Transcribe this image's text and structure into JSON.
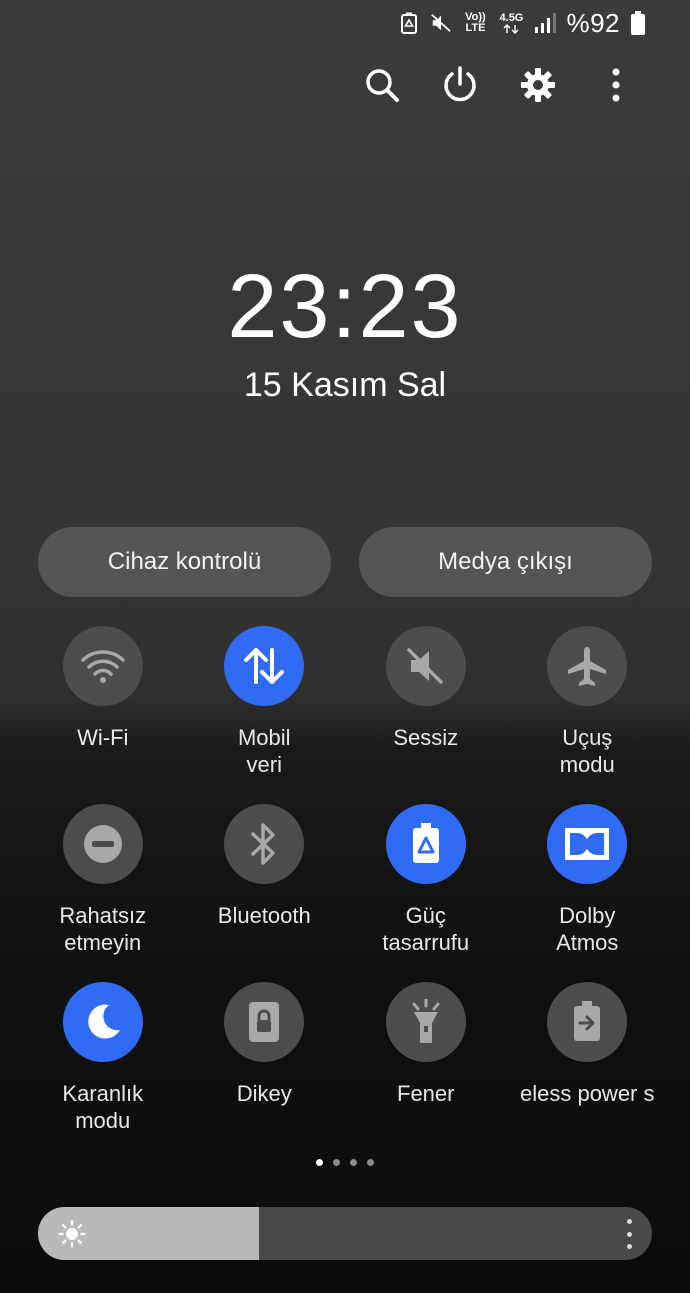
{
  "status_bar": {
    "icons": [
      "battery-saver-icon",
      "mute-icon",
      "volte-icon",
      "data-arrows-icon",
      "signal-icon",
      "battery-icon"
    ],
    "volte_top": "Vo))",
    "volte_bottom": "LTE",
    "network": "4.5G",
    "battery_percent": "%92"
  },
  "top_actions": [
    "search-icon",
    "power-icon",
    "gear-icon",
    "more-vertical-icon"
  ],
  "clock": {
    "time": "23:23",
    "date": "15 Kasım Sal"
  },
  "pills": {
    "device_control": "Cihaz kontrolü",
    "media_output": "Medya çıkışı"
  },
  "tiles": [
    {
      "label": "Wi-Fi",
      "icon": "wifi-icon",
      "on": false
    },
    {
      "label": "Mobil\nveri",
      "icon": "mobile-data-icon",
      "on": true
    },
    {
      "label": "Sessiz",
      "icon": "mute-icon",
      "on": false
    },
    {
      "label": "Uçuş\nmodu",
      "icon": "airplane-icon",
      "on": false
    },
    {
      "label": "Rahatsız\netmeyin",
      "icon": "do-not-disturb-icon",
      "on": false
    },
    {
      "label": "Bluetooth",
      "icon": "bluetooth-icon",
      "on": false
    },
    {
      "label": "Güç\ntasarrufu",
      "icon": "power-saving-icon",
      "on": true
    },
    {
      "label": "Dolby\nAtmos",
      "icon": "dolby-icon",
      "on": true
    },
    {
      "label": "Karanlık\nmodu",
      "icon": "moon-icon",
      "on": true
    },
    {
      "label": "Dikey",
      "icon": "portrait-lock-icon",
      "on": false
    },
    {
      "label": "Fener",
      "icon": "flashlight-icon",
      "on": false
    },
    {
      "label": "eless power s",
      "icon": "wireless-power-share-icon",
      "on": false
    }
  ],
  "page_indicator": {
    "count": 4,
    "active": 0
  },
  "brightness": {
    "level": 0.36,
    "icon": "sun-icon"
  },
  "colors": {
    "accent": "#2f6bf5",
    "tile_off": "#4d4d4d",
    "pill": "#555555"
  }
}
